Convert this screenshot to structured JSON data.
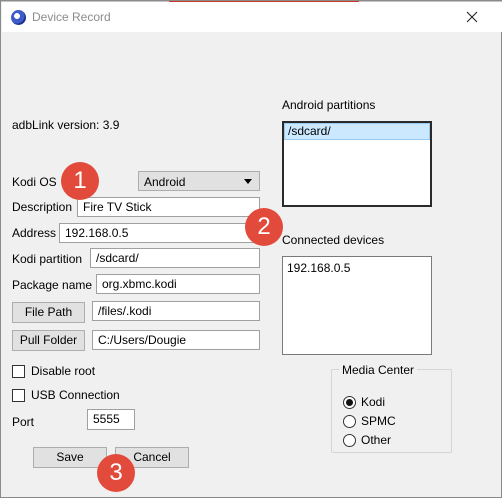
{
  "window": {
    "title": "Device Record"
  },
  "app": {
    "version_text": "adbLink version: 3.9"
  },
  "form": {
    "kodi_os_label": "Kodi OS",
    "kodi_os_value": "Android",
    "description_label": "Description",
    "description_value": "Fire TV Stick",
    "address_label": "Address",
    "address_value": "192.168.0.5",
    "partition_label": "Kodi partition",
    "partition_value": "/sdcard/",
    "package_label": "Package name",
    "package_value": "org.xbmc.kodi",
    "file_path_button": "File Path",
    "file_path_value": "/files/.kodi",
    "pull_folder_button": "Pull Folder",
    "pull_folder_value": "C:/Users/Dougie",
    "disable_root_label": "Disable root",
    "usb_connection_label": "USB Connection",
    "port_label": "Port",
    "port_value": "5555"
  },
  "android_partitions": {
    "label": "Android partitions",
    "items": [
      "/sdcard/"
    ]
  },
  "connected_devices": {
    "label": "Connected devices",
    "items": [
      "192.168.0.5"
    ]
  },
  "media_center": {
    "label": "Media Center",
    "options": [
      "Kodi",
      "SPMC",
      "Other"
    ],
    "selected": "Kodi"
  },
  "buttons": {
    "save": "Save",
    "cancel": "Cancel"
  },
  "annotations": [
    "1",
    "2",
    "3"
  ],
  "colors": {
    "annotation_badge": "#e24b3b",
    "selected_list_item": "#cce8ff",
    "focus_border": "#0078d7"
  }
}
